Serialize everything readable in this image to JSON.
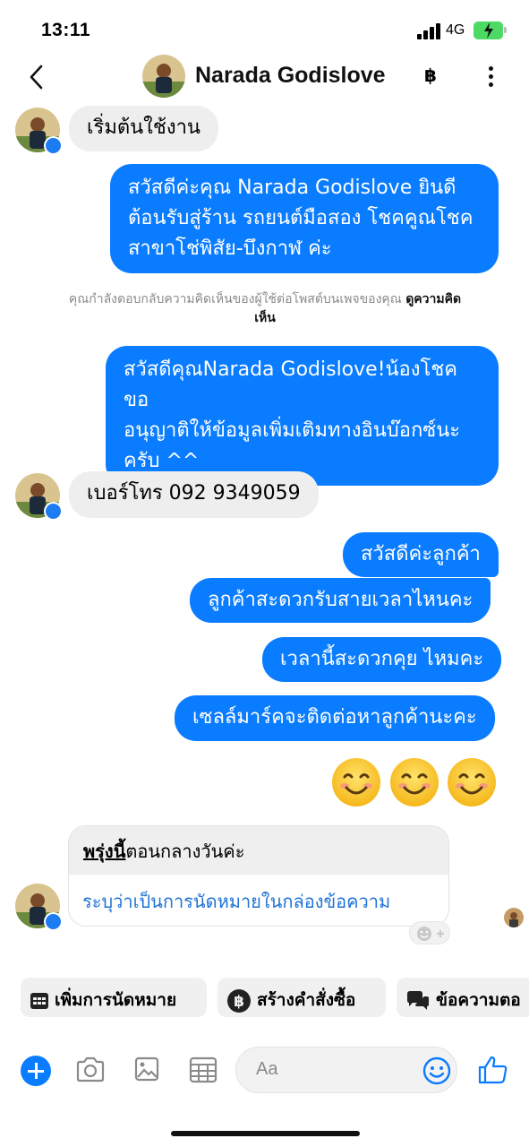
{
  "status_bar": {
    "time": "13:11",
    "network": "4G"
  },
  "header": {
    "title": "Narada Godislove",
    "baht_symbol": "฿"
  },
  "messages": {
    "m1": "เริ่มต้นใช้งาน",
    "m2_lines": [
      "สวัสดีค่ะคุณ Narada Godislove ยินดี",
      "ต้อนรับสู่ร้าน รถยนต์มือสอง โชคคูณโชค",
      "สาขาโช่พิสัย-บึงกาฬ ค่ะ"
    ],
    "notice_text": "คุณกำลังตอบกลับความคิดเห็นของผู้ใช้ต่อโพสต์บนเพจของคุณ ",
    "notice_link": "ดูความคิด",
    "notice_link_2": "เห็น",
    "m3_lines": [
      "สวัสดีคุณNarada Godislove!น้องโชคขอ",
      "อนุญาติให้ข้อมูลเพิ่มเติมทางอินบ๊อกซ์นะ",
      "ครับ ^^"
    ],
    "m4": "เบอร์โทร 092 9349059",
    "m5": "สวัสดีค่ะลูกค้า",
    "m6": "ลูกค้าสะดวกรับสายเวลาไหนคะ",
    "m7": "เวลานี้สะดวกคุย ไหมคะ",
    "m8": "เซลล์มาร์คจะติดต่อหาลูกค้านะคะ",
    "emojis": [
      "😊",
      "😊",
      "😊"
    ]
  },
  "appointment_card": {
    "underlined": "พรุ่งนี้",
    "rest": "ตอนกลางวันค่ะ",
    "action": "ระบุว่าเป็นการนัดหมายในกล่องข้อความ"
  },
  "quick_replies": [
    "เพิ่มการนัดหมาย",
    "สร้างคำสั่งซื้อ",
    "ข้อความตอ"
  ],
  "composer": {
    "placeholder": "Aa"
  },
  "colors": {
    "accent": "#0a7cff",
    "incoming_bubble": "#eeeeee",
    "battery": "#4cd964"
  }
}
